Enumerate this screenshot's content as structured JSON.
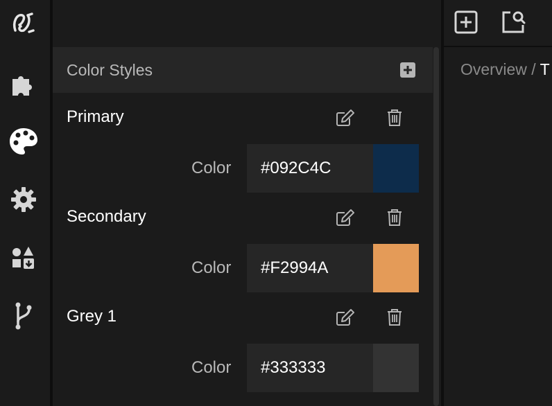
{
  "rail": {
    "items": [
      {
        "name": "logo-icon"
      },
      {
        "name": "plugins-icon"
      },
      {
        "name": "palette-icon"
      },
      {
        "name": "gear-icon"
      },
      {
        "name": "components-icon"
      },
      {
        "name": "git-branch-icon"
      }
    ]
  },
  "panel": {
    "title": "Color Styles",
    "add_icon": "plus-square-icon",
    "styles": [
      {
        "name": "Primary",
        "prop_label": "Color",
        "hex": "#092C4C",
        "swatch": "#0d2c4b"
      },
      {
        "name": "Secondary",
        "prop_label": "Color",
        "hex": "#F2994A",
        "swatch": "#e49b58"
      },
      {
        "name": "Grey 1",
        "prop_label": "Color",
        "hex": "#333333",
        "swatch": "#333333"
      }
    ]
  },
  "right": {
    "toolbar": [
      {
        "name": "add-page-icon"
      },
      {
        "name": "search-page-icon"
      }
    ],
    "breadcrumb": {
      "root": "Overview",
      "sep": " / ",
      "current": "T"
    }
  },
  "colors": {
    "background": "#1b1b1b",
    "panel_header": "#262626",
    "field": "#262626",
    "muted_text": "#b9b9b9",
    "icon": "#b5b5b5"
  }
}
